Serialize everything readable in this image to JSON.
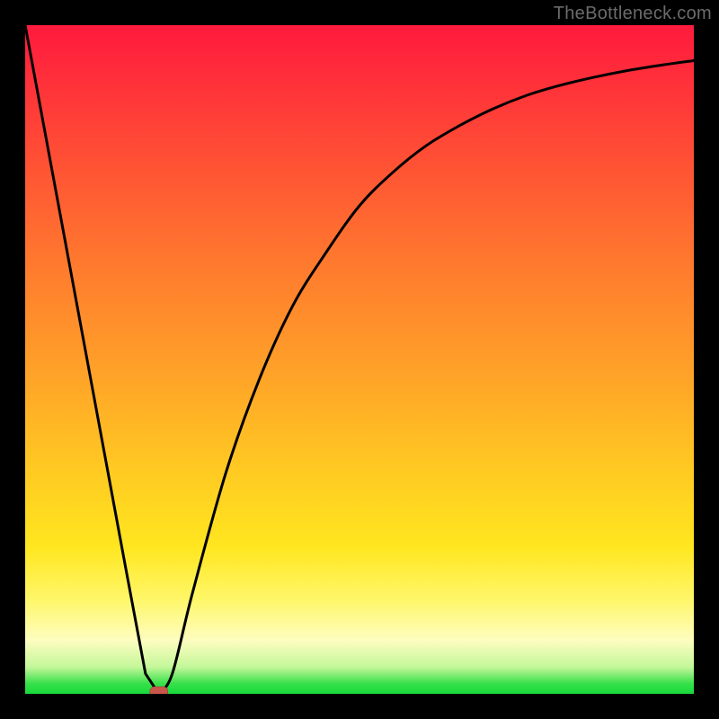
{
  "watermark": "TheBottleneck.com",
  "colors": {
    "frame": "#000000",
    "gradient_top": "#ff1a3d",
    "gradient_bottom": "#18d93a",
    "curve_stroke": "#000000",
    "marker_fill": "#c9564b"
  },
  "chart_data": {
    "type": "line",
    "title": "",
    "xlabel": "",
    "ylabel": "",
    "xlim": [
      0,
      100
    ],
    "ylim": [
      0,
      100
    ],
    "grid": false,
    "legend": false,
    "series": [
      {
        "name": "bottleneck-curve",
        "x": [
          0,
          5,
          10,
          15,
          18,
          20,
          22,
          25,
          30,
          35,
          40,
          45,
          50,
          55,
          60,
          65,
          70,
          75,
          80,
          85,
          90,
          95,
          100
        ],
        "y": [
          100,
          73,
          46,
          19,
          3,
          0,
          3,
          15,
          33,
          47,
          58,
          66,
          73,
          78,
          82,
          85,
          87.5,
          89.5,
          91,
          92.2,
          93.2,
          94,
          94.7
        ]
      }
    ],
    "marker": {
      "x": 20,
      "y": 0,
      "shape": "rounded-rect",
      "color": "#c9564b"
    },
    "notes": "V-shaped curve with vertex near x≈20%, y=0; left branch nearly linear to (0,100); right branch asymptotically approaches ~95%. No axis ticks or labels visible."
  }
}
